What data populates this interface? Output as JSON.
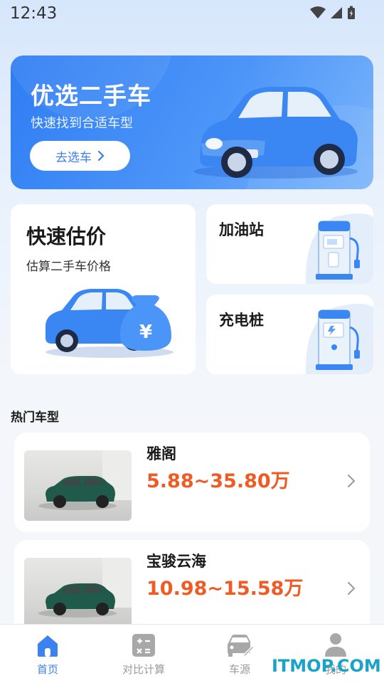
{
  "status_bar": {
    "time": "12:43"
  },
  "banner": {
    "title": "优选二手车",
    "subtitle": "快速找到合适车型",
    "button_label": "去选车"
  },
  "valuation": {
    "title": "快速估价",
    "subtitle": "估算二手车价格"
  },
  "gas_station": {
    "title": "加油站"
  },
  "charging": {
    "title": "充电桩"
  },
  "hot_models": {
    "title": "热门车型",
    "items": [
      {
        "name": "雅阁",
        "price": "5.88~35.80万"
      },
      {
        "name": "宝骏云海",
        "price": "10.98~15.58万"
      }
    ]
  },
  "bottom_nav": {
    "items": [
      {
        "label": "首页",
        "icon": "home-icon",
        "active": true
      },
      {
        "label": "对比计算",
        "icon": "calculator-icon",
        "active": false
      },
      {
        "label": "车源",
        "icon": "car-edit-icon",
        "active": false
      },
      {
        "label": "我的",
        "icon": "user-icon",
        "active": false
      }
    ]
  },
  "watermark": "ITMOP.COM",
  "colors": {
    "accent": "#3b82f0",
    "price": "#f05a23"
  }
}
